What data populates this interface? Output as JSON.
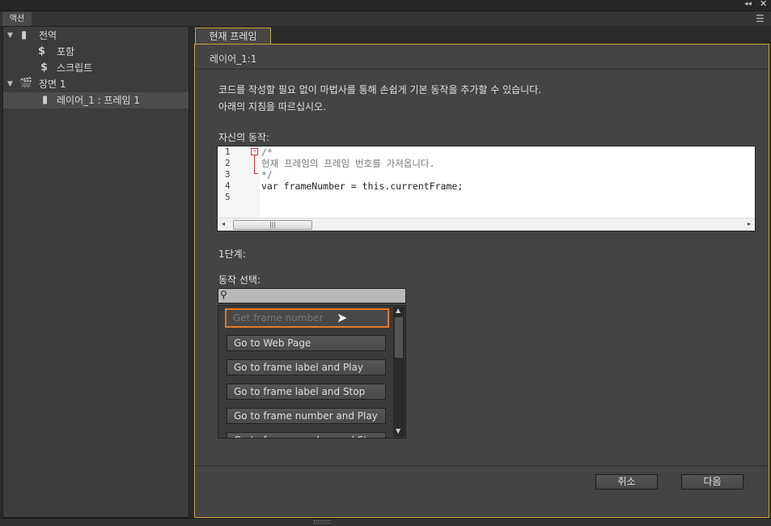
{
  "panel": {
    "tab": "액션"
  },
  "tree": [
    {
      "label": "전역",
      "icon": "document-icon"
    },
    {
      "label": "포함",
      "icon": "include-script-icon"
    },
    {
      "label": "스크립트",
      "icon": "script-icon"
    },
    {
      "label": "장면 1",
      "icon": "scene-clapper-icon"
    },
    {
      "label": "레이어_1 : 프레임 1",
      "icon": "layer-icon"
    }
  ],
  "main": {
    "tab": "현재 프레임",
    "subheader": "레이어_1:1",
    "intro1": "코드를 작성할 필요 없이 마법사를 통해 손쉽게 기본 동작을 추가할 수 있습니다.",
    "intro2": "아래의 지침을 따르십시오.",
    "own_action_label": "자신의 동작:",
    "code_lines": [
      "/*",
      "현재 프레임의 프레임 번호를 가져옵니다.",
      "*/",
      "var frameNumber = this.currentFrame;",
      ""
    ],
    "line_numbers": [
      "1",
      "2",
      "3",
      "4",
      "5"
    ],
    "step_label": "1단계:",
    "select_action_label": "동작 선택:",
    "search_placeholder": "",
    "actions": [
      "Get frame number",
      "Go to Web Page",
      "Go to frame label and Play",
      "Go to frame label and Stop",
      "Go to frame number and Play",
      "Go to frame number and Stop"
    ],
    "cancel": "취소",
    "next": "다음"
  },
  "colors": {
    "accent": "#c9a33a",
    "highlight": "#e07a28"
  }
}
